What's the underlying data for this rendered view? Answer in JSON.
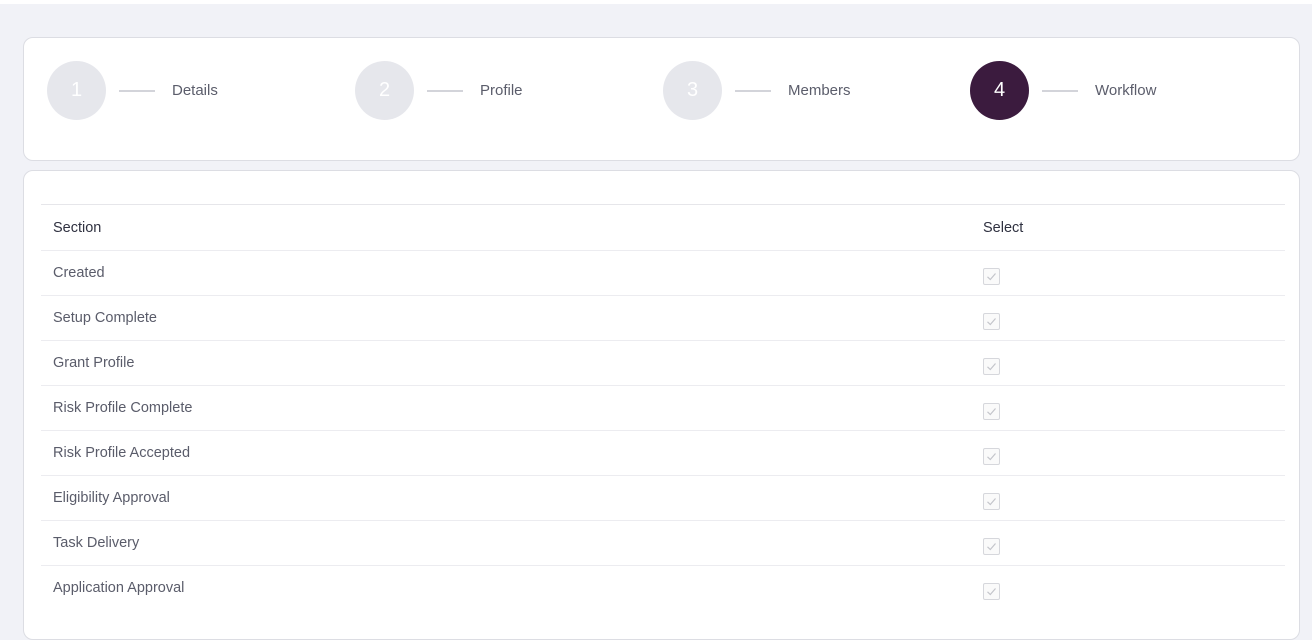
{
  "stepper": {
    "steps": [
      {
        "number": "1",
        "label": "Details",
        "state": "inactive"
      },
      {
        "number": "2",
        "label": "Profile",
        "state": "inactive"
      },
      {
        "number": "3",
        "label": "Members",
        "state": "inactive"
      },
      {
        "number": "4",
        "label": "Workflow",
        "state": "active"
      }
    ]
  },
  "table": {
    "headers": {
      "section": "Section",
      "select": "Select"
    },
    "rows": [
      {
        "section": "Created",
        "checked": true,
        "disabled": true
      },
      {
        "section": "Setup Complete",
        "checked": true,
        "disabled": true
      },
      {
        "section": "Grant Profile",
        "checked": true,
        "disabled": true
      },
      {
        "section": "Risk Profile Complete",
        "checked": true,
        "disabled": true
      },
      {
        "section": "Risk Profile Accepted",
        "checked": true,
        "disabled": true
      },
      {
        "section": "Eligibility Approval",
        "checked": true,
        "disabled": true
      },
      {
        "section": "Task Delivery",
        "checked": true,
        "disabled": true
      },
      {
        "section": "Application Approval",
        "checked": true,
        "disabled": true
      }
    ]
  },
  "colors": {
    "active_step": "#3b1b3e",
    "inactive_step": "#e6e7ec",
    "page_background": "#f1f2f7"
  }
}
